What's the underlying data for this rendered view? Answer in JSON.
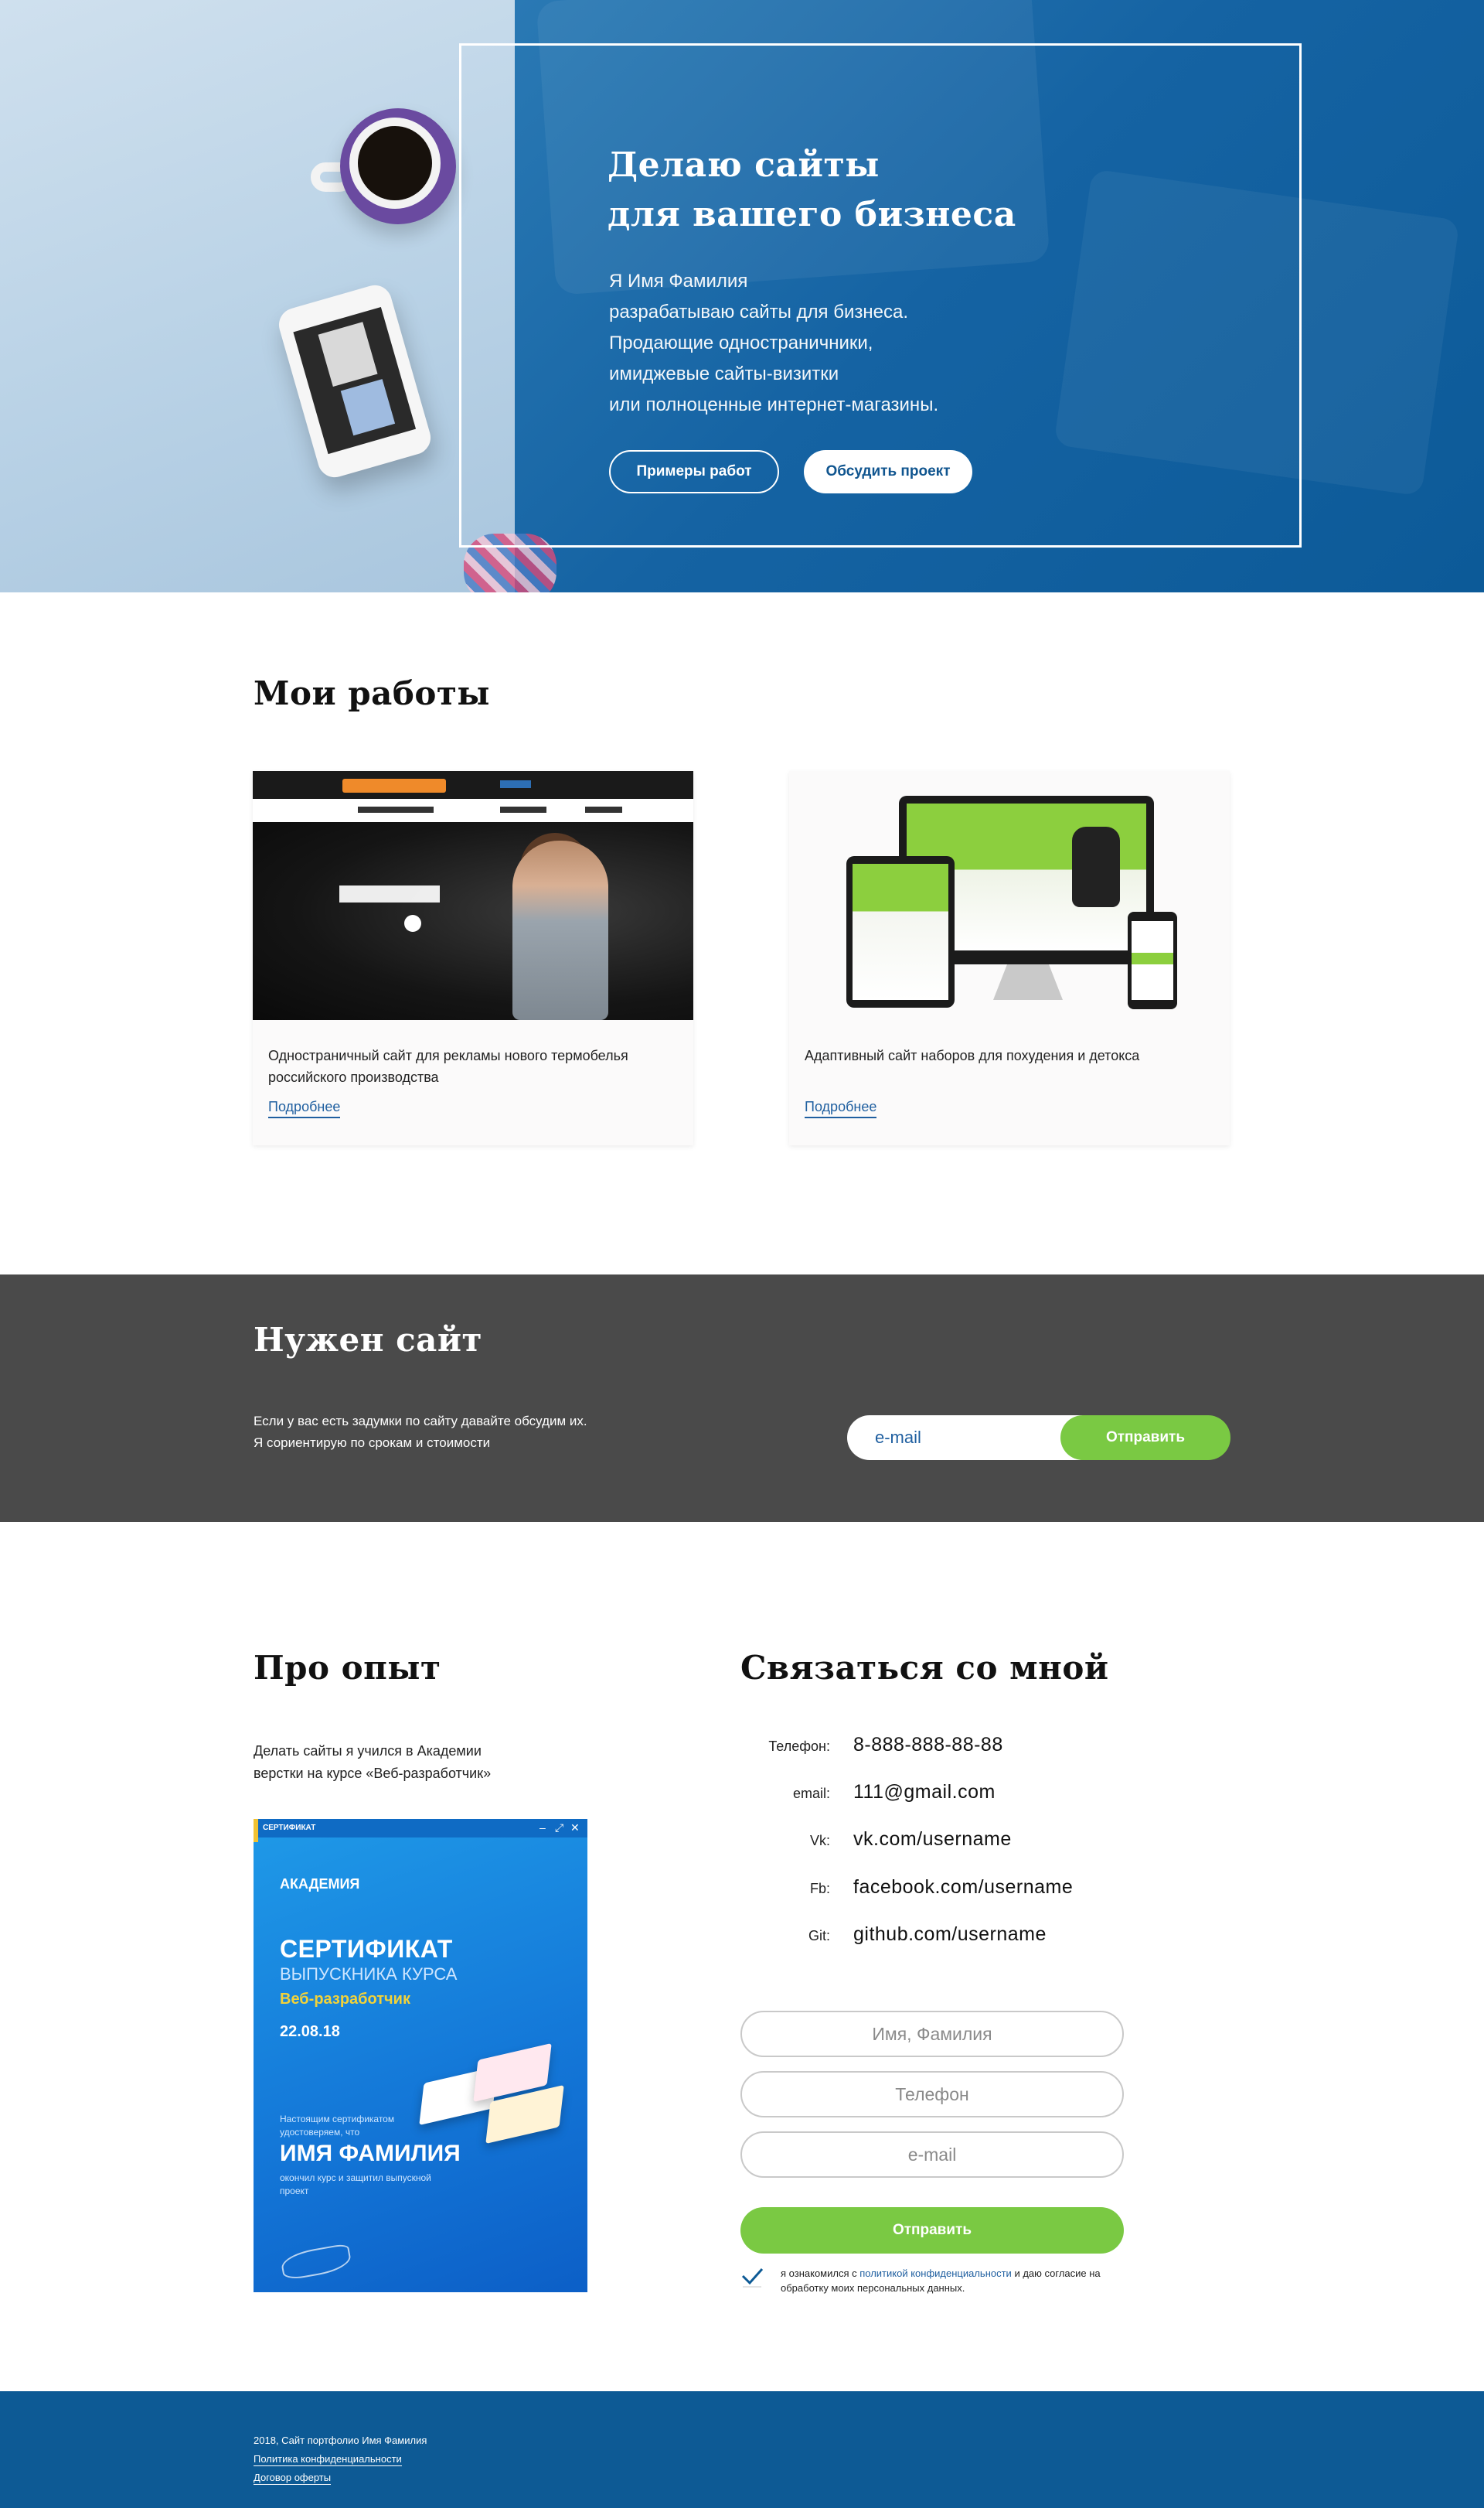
{
  "hero": {
    "title_line1": "Делаю сайты",
    "title_line2": "для вашего бизнеса",
    "subtitle_lines": [
      "Я Имя Фамилия",
      "разрабатываю сайты для бизнеса.",
      "Продающие одностраничники,",
      "имиджевые сайты-визитки",
      "или полноценные интернет-магазины."
    ],
    "btn_works": "Примеры работ",
    "btn_discuss": "Обсудить проект"
  },
  "works": {
    "title": "Мои работы",
    "items": [
      {
        "description": "Одностраничный сайт для рекламы нового термобелья российского производства",
        "link": "Подробнее"
      },
      {
        "description": "Адаптивный сайт наборов для похудения и детокса",
        "link": "Подробнее"
      }
    ]
  },
  "need": {
    "title": "Нужен сайт",
    "text_line1": "Если у вас есть задумки по сайту давайте обсудим их.",
    "text_line2": "Я сориентирую по срокам и стоимости",
    "email_placeholder": "e-mail",
    "send": "Отправить"
  },
  "experience": {
    "title": "Про опыт",
    "text_line1": "Делать сайты я учился в Академии",
    "text_line2": "верстки на курсе «Веб-разработчик»",
    "certificate": {
      "bar_title": "СЕРТИФИКАТ",
      "org": "АКАДЕМИЯ",
      "heading": "СЕРТИФИКАТ",
      "subheading": "ВЫПУСКНИКА КУРСА",
      "course": "Веб-разработчик",
      "date": "22.08.18",
      "note": "Настоящим сертификатом удостоверяем, что",
      "name": "ИМЯ ФАМИЛИЯ",
      "note2": "окончил курс и защитил выпускной проект"
    }
  },
  "contacts": {
    "title": "Связаться со мной",
    "rows": [
      {
        "label": "Телефон:",
        "value": "8-888-888-88-88"
      },
      {
        "label": "email:",
        "value": "111@gmail.com"
      },
      {
        "label": "Vk:",
        "value": "vk.com/username"
      },
      {
        "label": "Fb:",
        "value": "facebook.com/username"
      },
      {
        "label": "Git:",
        "value": "github.com/username"
      }
    ],
    "form": {
      "name_placeholder": "Имя, Фамилия",
      "phone_placeholder": "Телефон",
      "email_placeholder": "e-mail",
      "submit": "Отправить",
      "agree_prefix": "я ознакомился с ",
      "agree_link": "политикой конфиденциальности",
      "agree_suffix": " и даю согласие на обработку моих персональных данных."
    }
  },
  "footer": {
    "copyright": "2018, Сайт портфолио Имя Фамилия",
    "privacy": "Политика конфиденциальности",
    "offer": "Договор оферты"
  },
  "colors": {
    "brand_blue": "#0d5a95",
    "accent_green": "#7ac943",
    "dark_gray": "#4a4a4a",
    "link_blue": "#1f5fa0"
  }
}
